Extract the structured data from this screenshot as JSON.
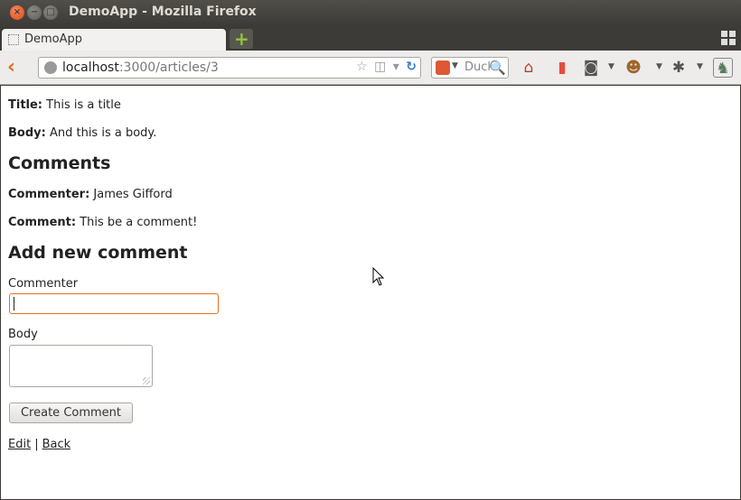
{
  "window": {
    "title": "DemoApp - Mozilla Firefox",
    "close_glyph": "×",
    "minimize_glyph": "−",
    "maximize_glyph": "□"
  },
  "tabs": [
    {
      "label": "DemoApp",
      "active": true
    }
  ],
  "new_tab_glyph": "+",
  "navbar": {
    "url_host": "localhost",
    "url_path": ":3000/articles/3",
    "search_text": "Duck",
    "accent_color": "#e36f1e"
  },
  "article": {
    "title_label": "Title:",
    "title_value": "This is a title",
    "body_label": "Body:",
    "body_value": "And this is a body."
  },
  "comments_heading": "Comments",
  "comments": [
    {
      "commenter_label": "Commenter:",
      "commenter_value": "James Gifford",
      "comment_label": "Comment:",
      "comment_value": "This be a comment!"
    }
  ],
  "form": {
    "heading": "Add new comment",
    "commenter_label": "Commenter",
    "commenter_value": "",
    "body_label": "Body",
    "body_value": "",
    "submit_label": "Create Comment"
  },
  "links": {
    "edit": "Edit",
    "separator": "|",
    "back": "Back"
  }
}
